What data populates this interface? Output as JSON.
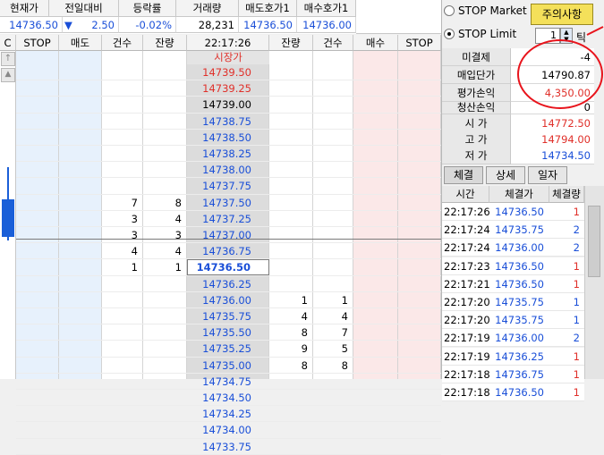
{
  "quote": {
    "headers": [
      "현재가",
      "전일대비",
      "등락률",
      "거래량",
      "매도호가1",
      "매수호가1"
    ],
    "current_price": "14736.50",
    "change_arrow": "▼",
    "change": "2.50",
    "change_rate": "-0.02%",
    "volume": "28,231",
    "ask1": "14736.50",
    "bid1": "14736.00"
  },
  "grid": {
    "headers": [
      "C",
      "STOP",
      "매도",
      "건수",
      "잔량",
      "22:17:26",
      "잔량",
      "건수",
      "매수",
      "STOP"
    ],
    "market_price_label": "시장가",
    "rows": [
      {
        "price": "14739.50",
        "color": "#e0302a"
      },
      {
        "price": "14739.25",
        "color": "#e0302a"
      },
      {
        "price": "14739.00",
        "color": "#000000"
      },
      {
        "price": "14738.75",
        "color": "#1a4fd8"
      },
      {
        "price": "14738.50",
        "color": "#1a4fd8"
      },
      {
        "price": "14738.25",
        "color": "#1a4fd8"
      },
      {
        "price": "14738.00",
        "color": "#1a4fd8"
      },
      {
        "price": "14737.75",
        "color": "#1a4fd8"
      },
      {
        "price": "14737.50",
        "color": "#1a4fd8",
        "ask_count": "7",
        "ask_qty": "8"
      },
      {
        "price": "14737.25",
        "color": "#1a4fd8",
        "ask_count": "3",
        "ask_qty": "4"
      },
      {
        "price": "14737.00",
        "color": "#1a4fd8",
        "ask_count": "3",
        "ask_qty": "3"
      },
      {
        "price": "14736.75",
        "color": "#1a4fd8",
        "ask_count": "4",
        "ask_qty": "4"
      },
      {
        "price": "14736.50",
        "color": "#1a4fd8",
        "ask_count": "1",
        "ask_qty": "1",
        "current": true
      },
      {
        "price": "14736.25",
        "color": "#1a4fd8"
      },
      {
        "price": "14736.00",
        "color": "#1a4fd8",
        "bid_qty": "1",
        "bid_count": "1"
      },
      {
        "price": "14735.75",
        "color": "#1a4fd8",
        "bid_qty": "4",
        "bid_count": "4"
      },
      {
        "price": "14735.50",
        "color": "#1a4fd8",
        "bid_qty": "8",
        "bid_count": "7"
      },
      {
        "price": "14735.25",
        "color": "#1a4fd8",
        "bid_qty": "9",
        "bid_count": "5"
      },
      {
        "price": "14735.00",
        "color": "#1a4fd8",
        "bid_qty": "8",
        "bid_count": "8"
      },
      {
        "price": "14734.75",
        "color": "#1a4fd8"
      },
      {
        "price": "14734.50",
        "color": "#1a4fd8"
      },
      {
        "price": "14734.25",
        "color": "#1a4fd8"
      },
      {
        "price": "14734.00",
        "color": "#1a4fd8"
      },
      {
        "price": "14733.75",
        "color": "#1a4fd8"
      }
    ]
  },
  "panel": {
    "stop_market": "STOP Market",
    "stop_limit": "STOP Limit",
    "caution_button": "주의사항",
    "tick_value": "1",
    "tick_unit": "틱",
    "unsettled_label": "미결제",
    "unsettled_value": "-4",
    "avg_price_label": "매입단가",
    "avg_price_value": "14790.87",
    "eval_pl_label": "평가손익",
    "eval_pl_value": "4,350.00",
    "settle_pl_label": "청산손익",
    "settle_pl_value": "0",
    "open_label": "시 가",
    "open_value": "14772.50",
    "high_label": "고 가",
    "high_value": "14794.00",
    "low_label": "저 가",
    "low_value": "14734.50",
    "tabs": [
      "체결",
      "상세",
      "일자"
    ],
    "trade_headers": [
      "시간",
      "체결가",
      "체결량"
    ],
    "trades": [
      {
        "time": "22:17:26",
        "price": "14736.50",
        "qty": "1",
        "qty_color": "#e0302a"
      },
      {
        "time": "22:17:24",
        "price": "14735.75",
        "qty": "2",
        "qty_color": "#1a4fd8"
      },
      {
        "time": "22:17:24",
        "price": "14736.00",
        "qty": "2",
        "qty_color": "#1a4fd8"
      },
      {
        "time": "22:17:23",
        "price": "14736.50",
        "qty": "1",
        "qty_color": "#e0302a"
      },
      {
        "time": "22:17:21",
        "price": "14736.50",
        "qty": "1",
        "qty_color": "#e0302a"
      },
      {
        "time": "22:17:20",
        "price": "14735.75",
        "qty": "1",
        "qty_color": "#1a4fd8"
      },
      {
        "time": "22:17:20",
        "price": "14735.75",
        "qty": "1",
        "qty_color": "#1a4fd8"
      },
      {
        "time": "22:17:19",
        "price": "14736.00",
        "qty": "2",
        "qty_color": "#1a4fd8"
      },
      {
        "time": "22:17:19",
        "price": "14736.25",
        "qty": "1",
        "qty_color": "#e0302a"
      },
      {
        "time": "22:17:18",
        "price": "14736.75",
        "qty": "1",
        "qty_color": "#e0302a"
      },
      {
        "time": "22:17:18",
        "price": "14736.50",
        "qty": "1",
        "qty_color": "#e0302a"
      }
    ]
  },
  "colors": {
    "up": "#e0302a",
    "down": "#1a4fd8",
    "stop_col_bg": "#e7f1fc",
    "buy_col_bg": "#fbe8e8",
    "annotation": "#e8141c"
  }
}
